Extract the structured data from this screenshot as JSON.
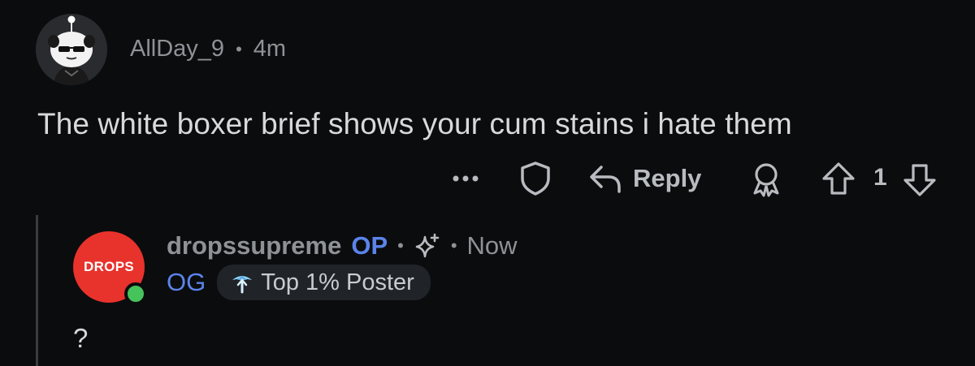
{
  "parent_comment": {
    "username": "AllDay_9",
    "separator": "•",
    "timestamp": "4m",
    "text": "The white boxer brief shows your cum stains i hate them",
    "avatar_icon": "snoo-sunglasses-avatar"
  },
  "actions": {
    "more_icon": "ellipsis-icon",
    "shield_icon": "shield-icon",
    "reply_label": "Reply",
    "award_icon": "award-icon",
    "upvote_icon": "upvote-arrow-icon",
    "vote_count": "1",
    "downvote_icon": "downvote-arrow-icon"
  },
  "reply_comment": {
    "username": "dropssupreme",
    "op_badge": "OP",
    "separator": "•",
    "timestamp": "Now",
    "avatar_text": "DROPS",
    "flair": "OG",
    "achievement": "Top 1% Poster",
    "text": "?",
    "colors": {
      "avatar_bg": "#e8322c",
      "op_blue": "#5b84ea",
      "online": "#46c35a"
    }
  }
}
